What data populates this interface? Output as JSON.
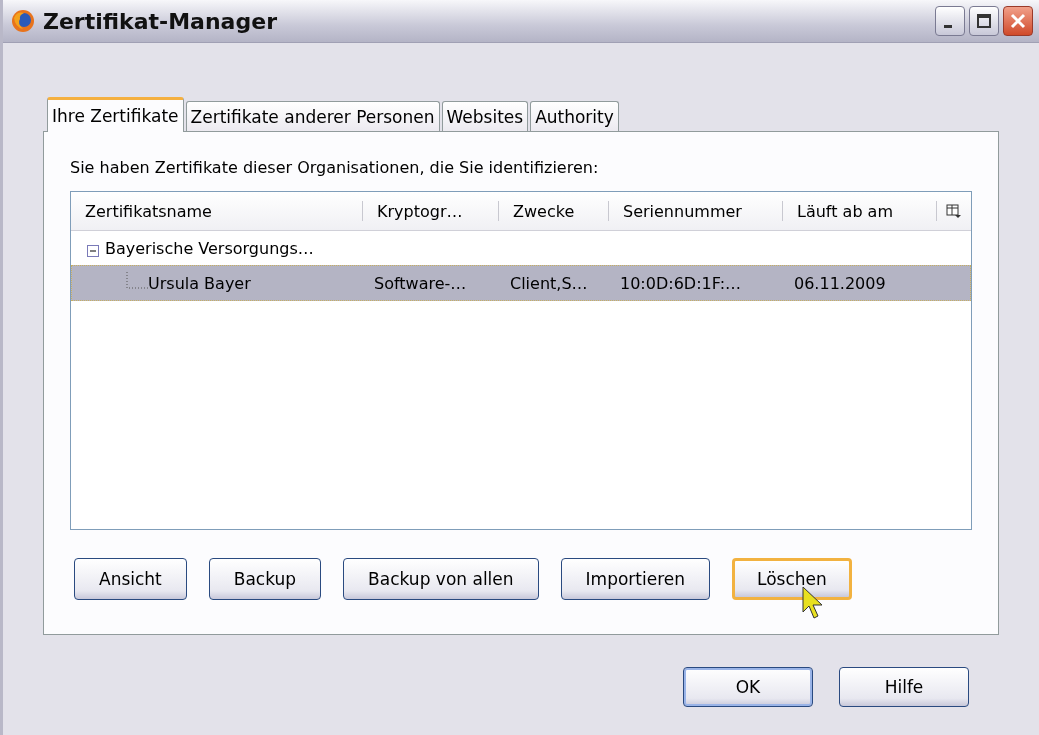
{
  "window": {
    "title": "Zertifikat-Manager"
  },
  "tabs": [
    {
      "label": "Ihre Zertifikate",
      "selected": true
    },
    {
      "label": "Zertifikate anderer Personen",
      "selected": false
    },
    {
      "label": "Websites",
      "selected": false
    },
    {
      "label": "Authority",
      "selected": false
    }
  ],
  "description": "Sie haben Zertifikate dieser Organisationen, die Sie identifizieren:",
  "tree": {
    "columns": [
      "Zertifikatsname",
      "Kryptogr…",
      "Zwecke",
      "Seriennummer",
      "Läuft ab am"
    ],
    "rows": [
      {
        "cells": [
          "Bayerische Versorgungs…"
        ],
        "expanded": true,
        "selected": false,
        "children": [
          {
            "cells": [
              "Ursula Bayer",
              "Software-…",
              "Client,S…",
              "10:0D:6D:1F:…",
              "06.11.2009"
            ],
            "selected": true
          }
        ]
      }
    ]
  },
  "actions": [
    {
      "label": "Ansicht",
      "hovered": false
    },
    {
      "label": "Backup",
      "hovered": false
    },
    {
      "label": "Backup von allen",
      "hovered": false
    },
    {
      "label": "Importieren",
      "hovered": false
    },
    {
      "label": "Löschen",
      "hovered": true
    }
  ],
  "footer_buttons": [
    {
      "label": "OK",
      "default": true
    },
    {
      "label": "Hilfe",
      "default": false
    }
  ]
}
